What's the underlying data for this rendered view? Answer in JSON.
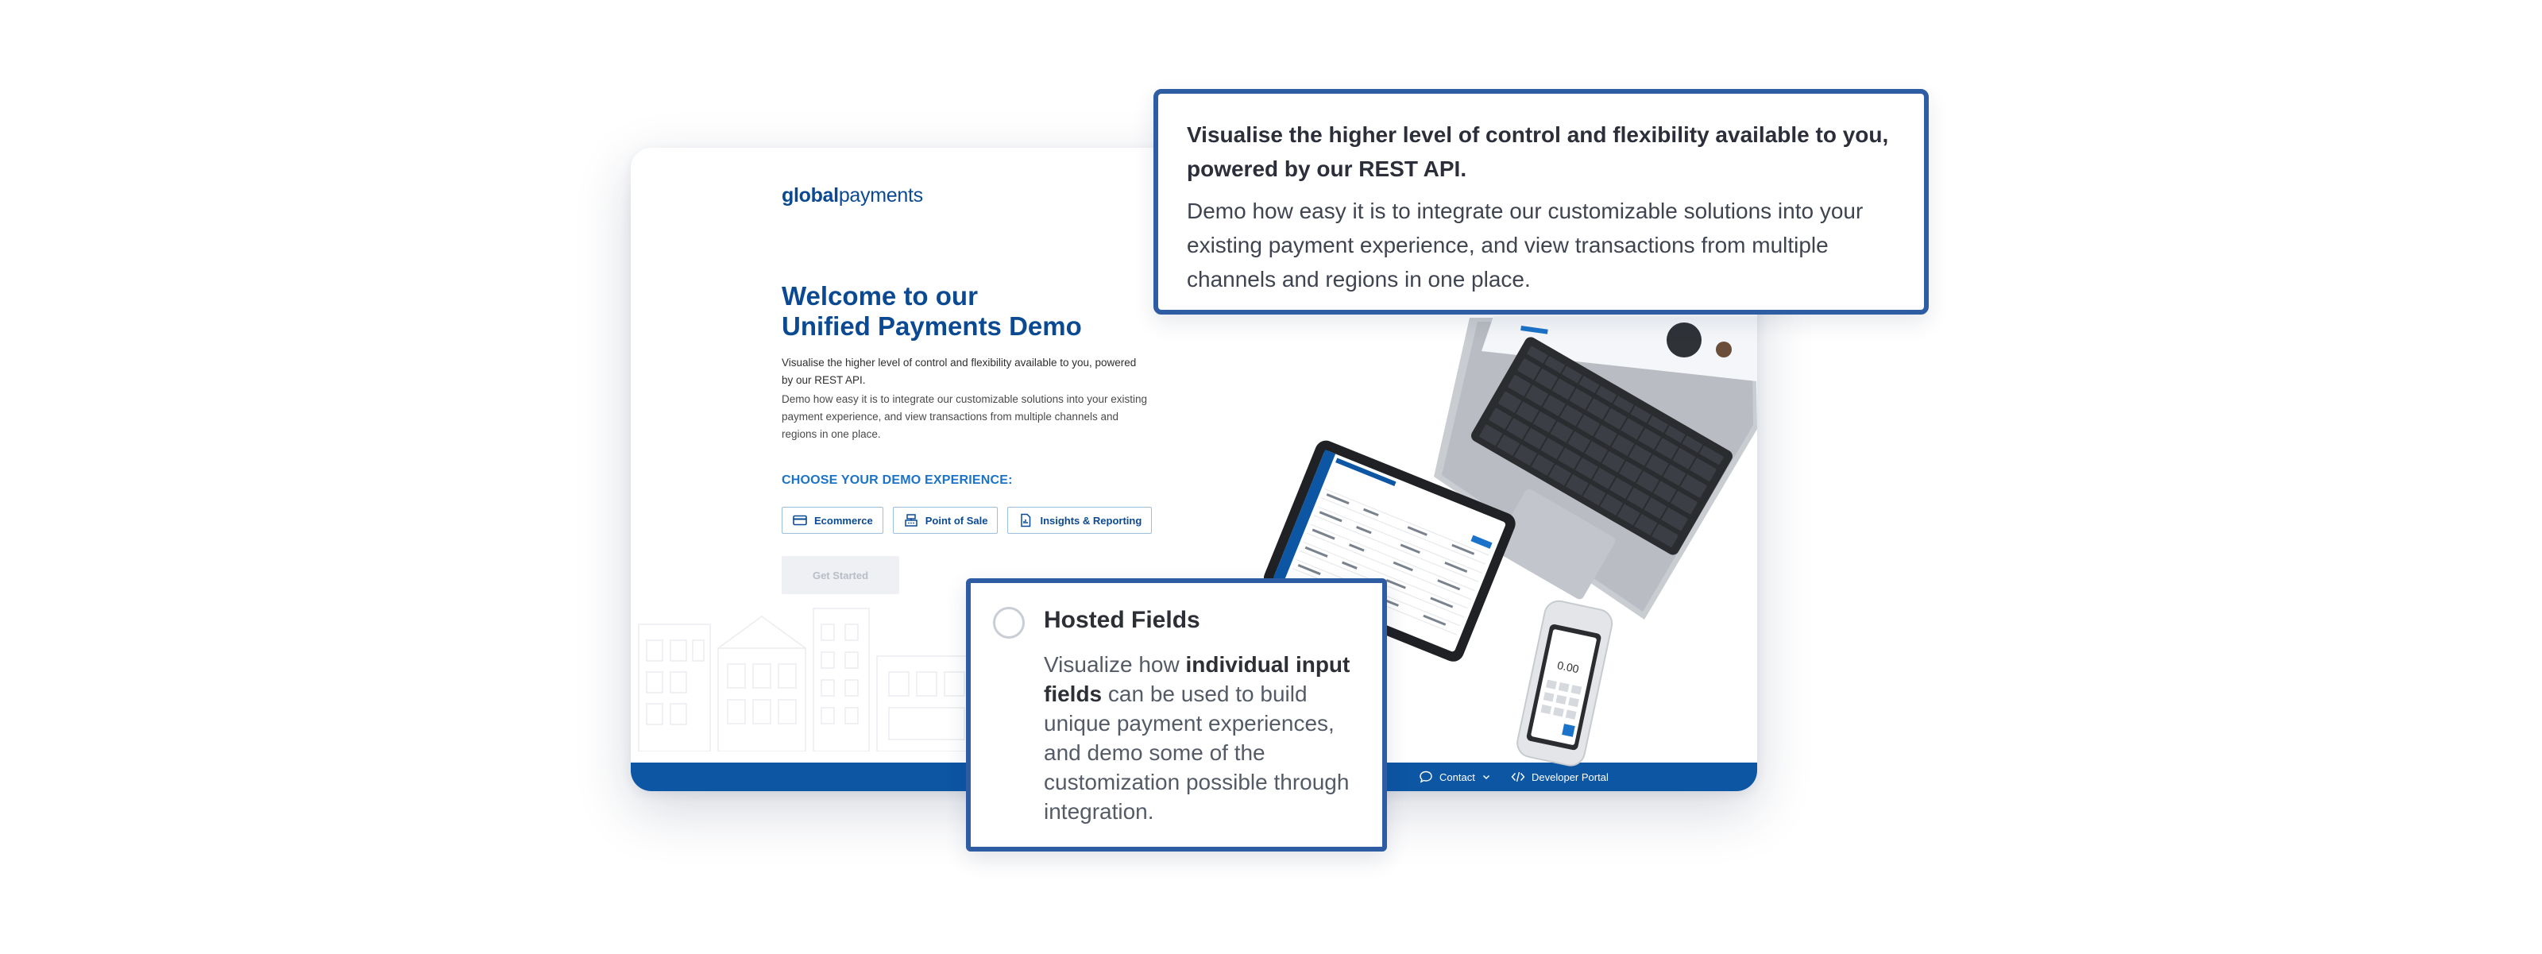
{
  "brand": {
    "logo_bold": "global",
    "logo_light": "payments"
  },
  "hero": {
    "title_line1": "Welcome to our",
    "title_line2": "Unified Payments Demo",
    "lead": "Visualise the higher level of control and flexibility available to you, powered by our REST API.",
    "sub": "Demo how easy it is to integrate our customizable solutions into your existing payment experience, and view transactions from multiple channels and regions in one place."
  },
  "demo_choice": {
    "heading": "CHOOSE YOUR DEMO EXPERIENCE:",
    "options": [
      {
        "label": "Ecommerce",
        "icon": "credit-card-icon"
      },
      {
        "label": "Point of Sale",
        "icon": "cash-register-icon"
      },
      {
        "label": "Insights & Reporting",
        "icon": "report-document-icon"
      }
    ],
    "get_started": "Get Started"
  },
  "footer": {
    "contact": "Contact",
    "developer_portal": "Developer Portal"
  },
  "callout_top": {
    "line1": "Visualise the higher level of control and flexibility available to you, powered by our REST API.",
    "line2": "Demo how easy it is to integrate our customizable solutions into your existing payment experience, and view transactions from multiple channels and regions in one place."
  },
  "hosted_fields": {
    "title": "Hosted Fields",
    "desc_pre": "Visualize how ",
    "desc_bold": "individual input fields",
    "desc_post": " can be used to build unique payment experiences, and demo some of the customization possible through integration."
  },
  "colors": {
    "brand_blue": "#0b4a93",
    "accent_blue": "#1a73c8",
    "footer_blue": "#0d56a4",
    "callout_border": "#2e5da4"
  }
}
